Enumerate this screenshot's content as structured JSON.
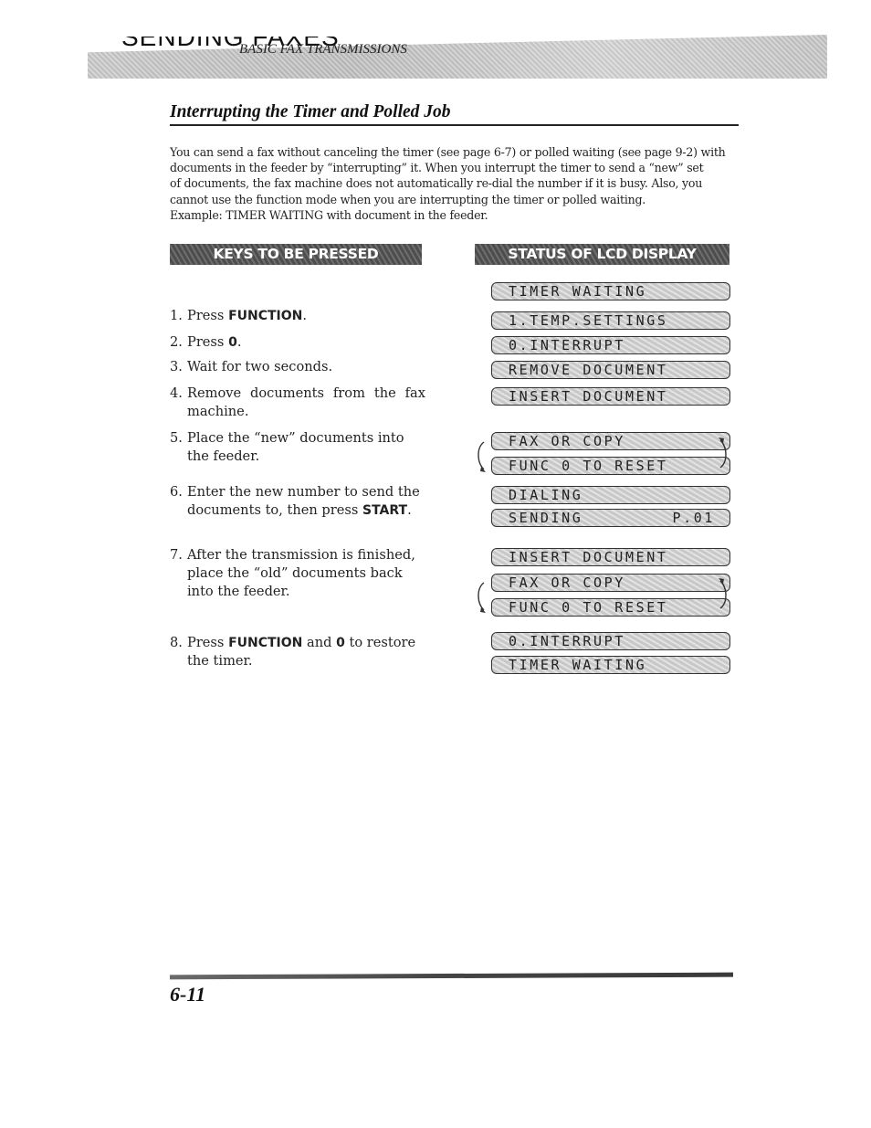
{
  "header": {
    "chapter": "SENDING FAXES",
    "section": "BASIC FAX TRANSMISSIONS"
  },
  "section": {
    "title": "Interrupting the Timer and Polled Job",
    "intro_lines": [
      "You can send a fax without canceling the timer (see page 6-7) or polled waiting (see page 9-2) with",
      "documents in the feeder by “interrupting” it. When you interrupt the timer to send a “new” set",
      "of documents, the fax machine does not automatically re-dial the number if it is busy. Also, you",
      "cannot use the function mode when you are interrupting the timer or polled waiting.",
      "Example: TIMER WAITING with document in the feeder."
    ]
  },
  "columns": {
    "keys_header": "KEYS TO BE PRESSED",
    "status_header": "STATUS OF LCD DISPLAY"
  },
  "steps": [
    {
      "num": "1.",
      "pre": "Press ",
      "key": "FUNCTION",
      "post": "."
    },
    {
      "num": "2.",
      "pre": "Press ",
      "key": "0",
      "post": "."
    },
    {
      "num": "3.",
      "pre": "Wait for two seconds.",
      "key": "",
      "post": ""
    },
    {
      "num": "4.",
      "pre": "Remove documents from the fax machine.",
      "key": "",
      "post": ""
    },
    {
      "num": "5.",
      "pre": "Place the “new” documents into the feeder.",
      "key": "",
      "post": ""
    },
    {
      "num": "6.",
      "pre": "Enter the new number to send the documents to, then press ",
      "key": "START",
      "post": "."
    },
    {
      "num": "7.",
      "pre": "After the transmission is finished, place the “old” documents back into the feeder.",
      "key": "",
      "post": ""
    },
    {
      "num": "8.",
      "pre": "Press ",
      "key": "FUNCTION",
      "post": " and ",
      "key2": "0",
      "post2": " to restore the timer."
    }
  ],
  "lcd": [
    {
      "text": "TIMER WAITING"
    },
    {
      "text": "1.TEMP.SETTINGS"
    },
    {
      "text": "0.INTERRUPT"
    },
    {
      "text": "REMOVE DOCUMENT"
    },
    {
      "text": "INSERT DOCUMENT"
    },
    {
      "text": "FAX OR COPY"
    },
    {
      "text": "FUNC 0 TO RESET"
    },
    {
      "text": "DIALING"
    },
    {
      "text": "SENDING",
      "right": "P.01"
    },
    {
      "text": "INSERT DOCUMENT"
    },
    {
      "text": "FAX OR COPY"
    },
    {
      "text": "FUNC 0 TO RESET"
    },
    {
      "text": "0.INTERRUPT"
    },
    {
      "text": "TIMER WAITING"
    }
  ],
  "footer": {
    "page_number": "6-11"
  }
}
